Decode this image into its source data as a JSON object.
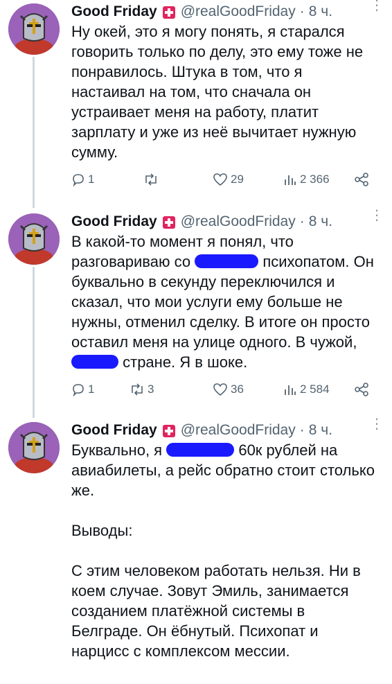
{
  "tweets": [
    {
      "author": "Good Friday",
      "handle": "@realGoodFriday",
      "sep": "·",
      "time": "8 ч.",
      "text": [
        "Ну окей, это я могу понять, я старался говорить только по делу, это ему тоже не понравилось. Штука в том, что я настаивал на том, что сначала он устраивает меня на работу, платит зарплату и уже из неё вычитает нужную сумму."
      ],
      "replies": "1",
      "retweets": "",
      "likes": "29",
      "views": "2 366"
    },
    {
      "author": "Good Friday",
      "handle": "@realGoodFriday",
      "sep": "·",
      "time": "8 ч.",
      "text_a": "В какой-то момент я понял, что разговариваю со",
      "text_b": "психопатом. Он буквально в секунду переключился и сказал, что мои услуги ему больше не нужны, отменил сделку. В итоге он просто оставил меня на улице одного. В чужой,",
      "text_c": "стране. Я в шоке.",
      "replies": "1",
      "retweets": "3",
      "likes": "36",
      "views": "2 584"
    },
    {
      "author": "Good Friday",
      "handle": "@realGoodFriday",
      "sep": "·",
      "time": "8 ч.",
      "text_a": "Буквально, я",
      "text_b": "60к рублей на авиабилеты, а рейс обратно стоит столько же.",
      "p2": "Выводы:",
      "p3": "С этим человеком работать нельзя. Ни в коем случае. Зовут Эмиль, занимается созданием платёжной системы в Белграде. Он ёбнутый. Психопат и нарцисс с комплексом мессии."
    }
  ],
  "colors": {
    "accent_redaction": "#1a1aff",
    "verified_badge": "#e0245e",
    "muted": "#536471"
  },
  "icons": [
    "reply-icon",
    "retweet-icon",
    "like-icon",
    "views-icon",
    "share-icon",
    "more-icon"
  ]
}
